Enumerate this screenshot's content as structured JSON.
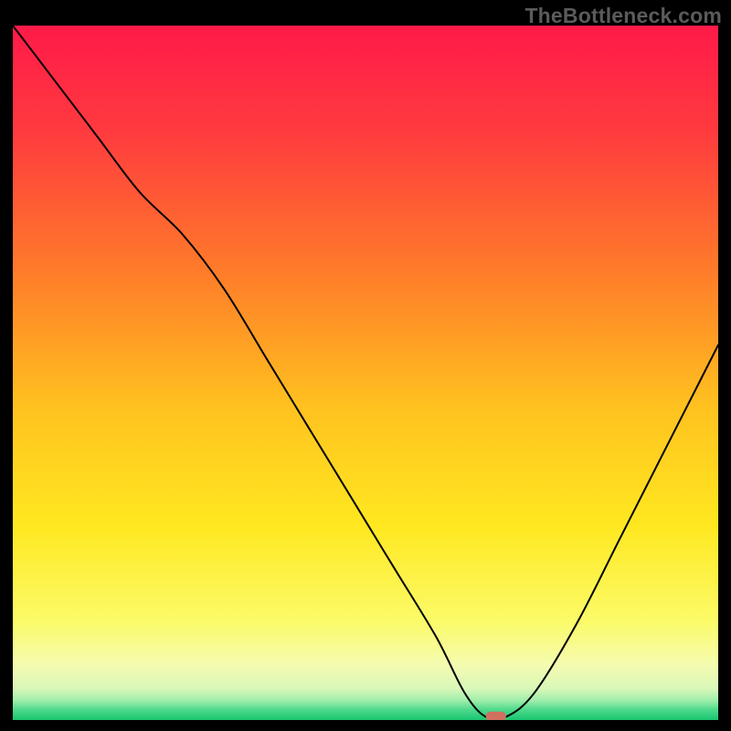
{
  "watermark": "TheBottleneck.com",
  "chart_data": {
    "type": "line",
    "title": "",
    "xlabel": "",
    "ylabel": "",
    "xlim": [
      0,
      100
    ],
    "ylim": [
      0,
      100
    ],
    "grid": false,
    "legend": false,
    "background": {
      "type": "vertical-gradient",
      "description": "Saturated red at top fading through orange and yellow to a thin green band at the bottom, indicating bottleneck severity (red = high bottleneck, green = optimal).",
      "stops": [
        {
          "pos": 0.0,
          "color": "#ff1a49"
        },
        {
          "pos": 0.15,
          "color": "#ff3a3f"
        },
        {
          "pos": 0.35,
          "color": "#ff7a2a"
        },
        {
          "pos": 0.55,
          "color": "#ffc21f"
        },
        {
          "pos": 0.72,
          "color": "#ffe820"
        },
        {
          "pos": 0.86,
          "color": "#fbfb6a"
        },
        {
          "pos": 0.92,
          "color": "#f5fbb0"
        },
        {
          "pos": 0.955,
          "color": "#d9f7b8"
        },
        {
          "pos": 0.972,
          "color": "#9eeeab"
        },
        {
          "pos": 0.985,
          "color": "#4fd98c"
        },
        {
          "pos": 1.0,
          "color": "#18c56f"
        }
      ]
    },
    "series": [
      {
        "name": "bottleneck-curve",
        "color": "#000000",
        "stroke_width": 2,
        "x": [
          0,
          6,
          12,
          18,
          24,
          30,
          36,
          42,
          48,
          54,
          60,
          64,
          67,
          70,
          74,
          80,
          86,
          92,
          100
        ],
        "values": [
          100,
          92,
          84,
          76,
          70,
          62,
          52,
          42,
          32,
          22,
          12,
          4,
          0.5,
          0.5,
          4,
          14,
          26,
          38,
          54
        ]
      }
    ],
    "marker": {
      "name": "current-config",
      "x": 68.5,
      "y": 0.5,
      "color": "#d0705e",
      "shape": "rounded-pill"
    }
  }
}
